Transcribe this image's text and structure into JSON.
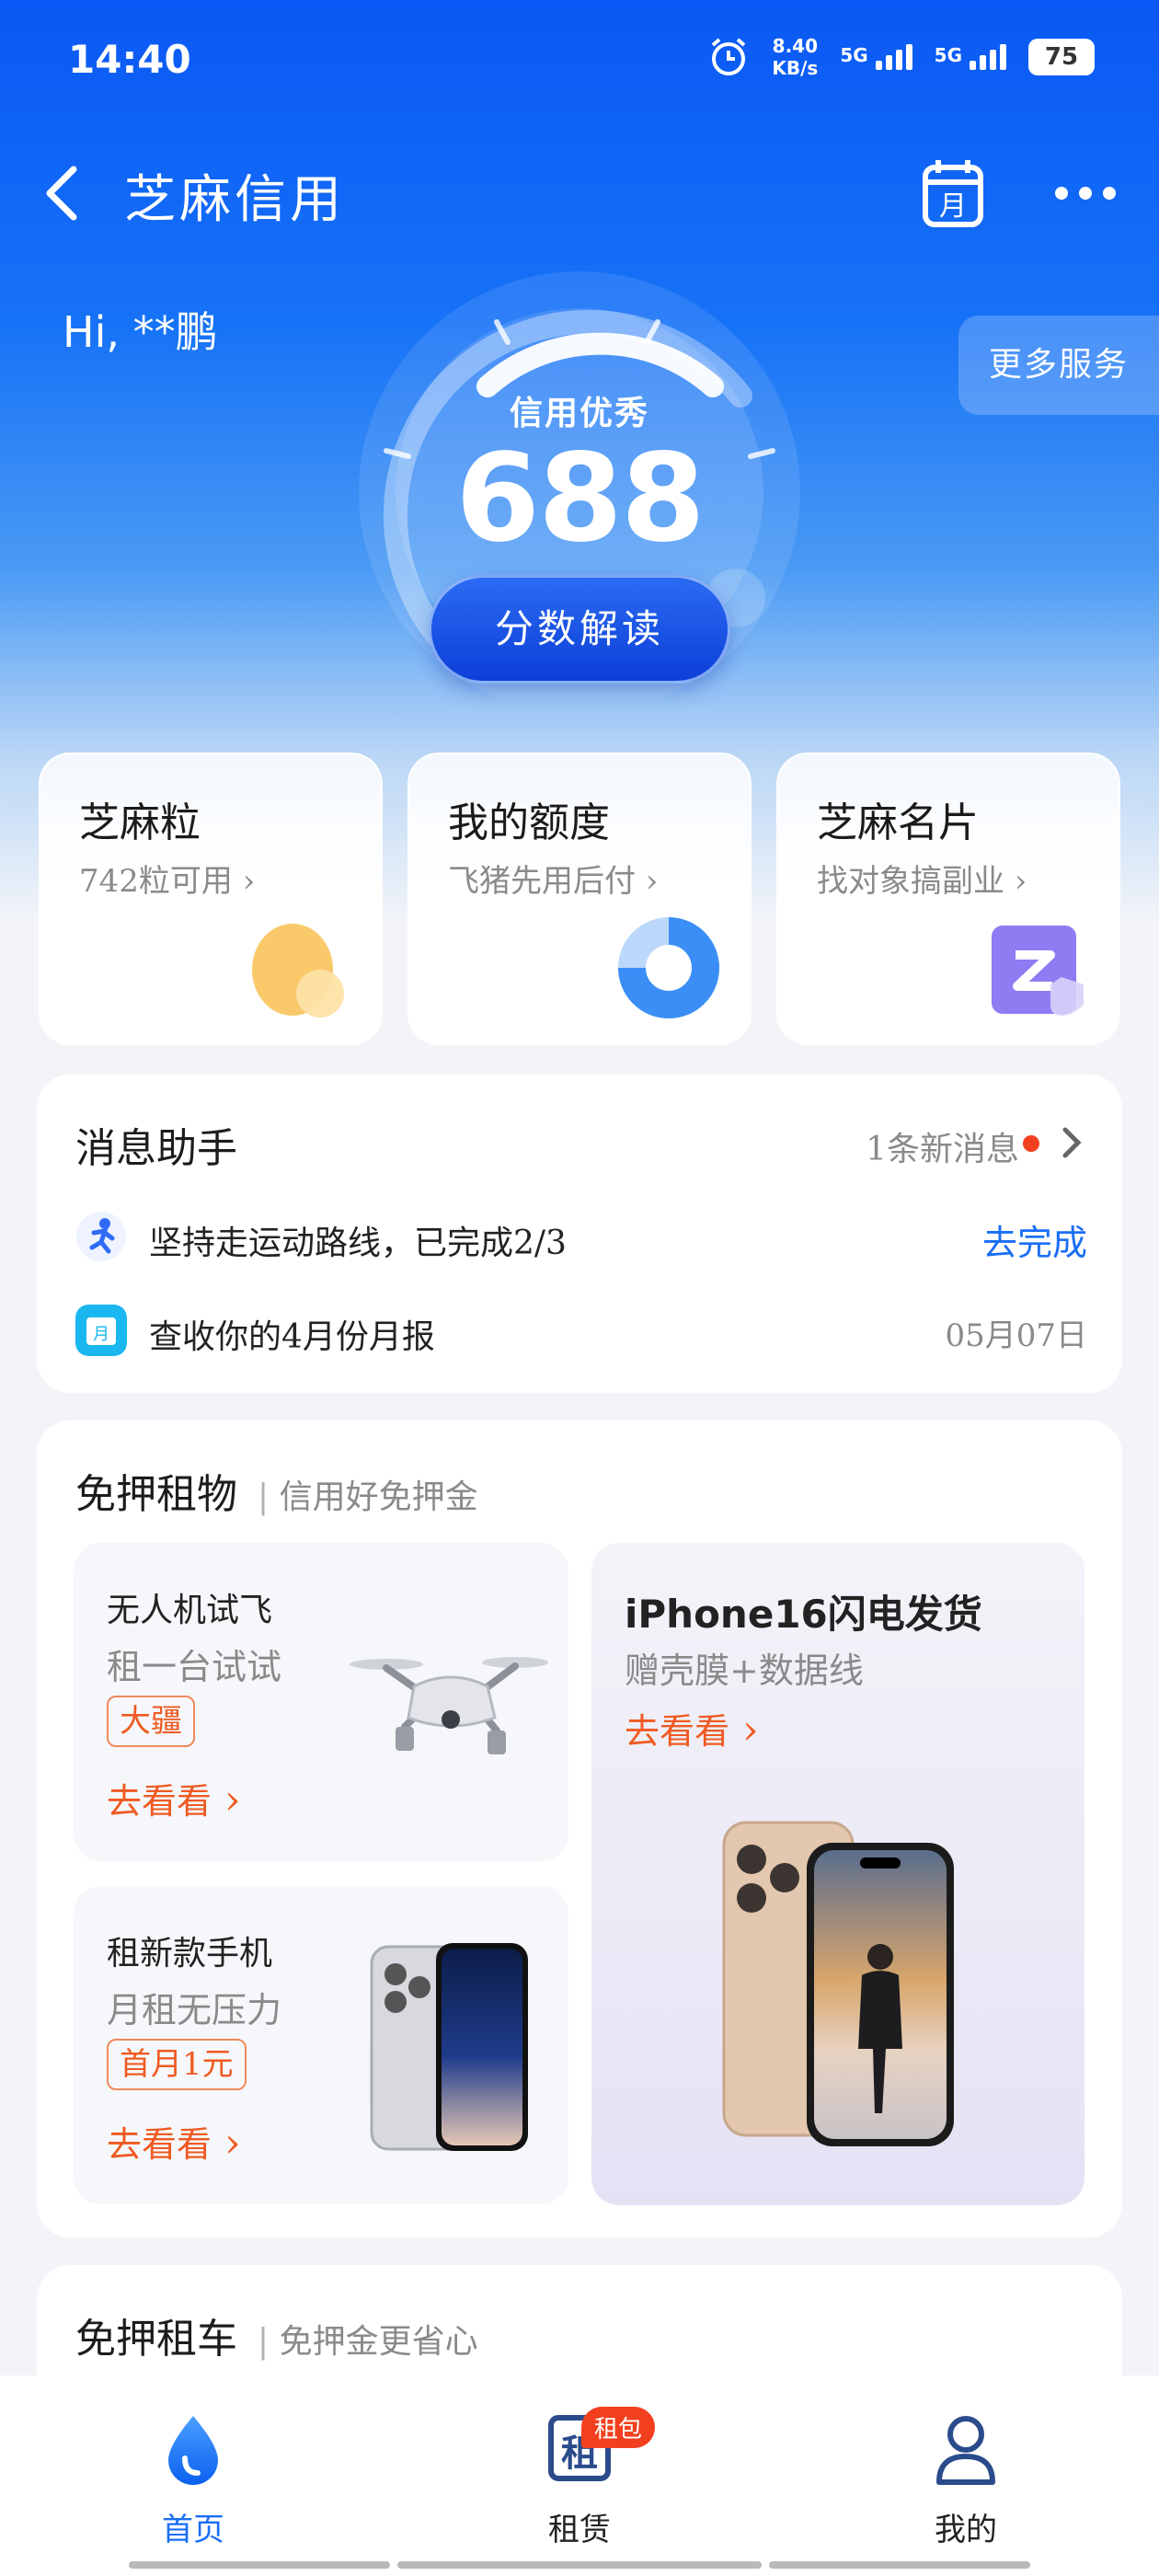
{
  "status": {
    "time": "14:40",
    "speed_value": "8.40",
    "speed_unit": "KB/s",
    "sim1": "5G",
    "sim2": "5G",
    "battery": "75"
  },
  "nav": {
    "title": "芝麻信用",
    "calendar_glyph": "月"
  },
  "greeting": "Hi, **鹏",
  "more_services": "更多服务",
  "score": {
    "level": "信用优秀",
    "value": "688",
    "button": "分数解读"
  },
  "quick_cards": [
    {
      "title": "芝麻粒",
      "subtitle": "742粒可用 ›"
    },
    {
      "title": "我的额度",
      "subtitle": "飞猪先用后付 ›"
    },
    {
      "title": "芝麻名片",
      "subtitle": "找对象搞副业 ›"
    }
  ],
  "messages": {
    "title": "消息助手",
    "new_count": "1条新消息",
    "items": [
      {
        "text": "坚持走运动路线，已完成2/3",
        "action": "去完成"
      },
      {
        "text": "查收你的4月份月报",
        "date": "05月07日",
        "icon_glyph": "月"
      }
    ]
  },
  "rent": {
    "title": "免押租物",
    "subtitle": "信用好免押金",
    "tiles": [
      {
        "title": "无人机试飞",
        "subtitle": "租一台试试",
        "tag": "大疆",
        "link": "去看看"
      },
      {
        "title": "租新款手机",
        "subtitle": "月租无压力",
        "tag": "首月1元",
        "link": "去看看"
      }
    ],
    "featured": {
      "title": "iPhone16闪电发货",
      "subtitle": "赠壳膜+数据线",
      "link": "去看看"
    }
  },
  "car": {
    "title": "免押租车",
    "subtitle": "免押金更省心"
  },
  "tabbar": [
    {
      "label": "首页",
      "active": true
    },
    {
      "label": "租赁",
      "badge": "租包",
      "glyph": "租"
    },
    {
      "label": "我的"
    }
  ],
  "colors": {
    "primary": "#1a6ef5",
    "accent": "#ef5a22",
    "badge": "#f2401e"
  }
}
